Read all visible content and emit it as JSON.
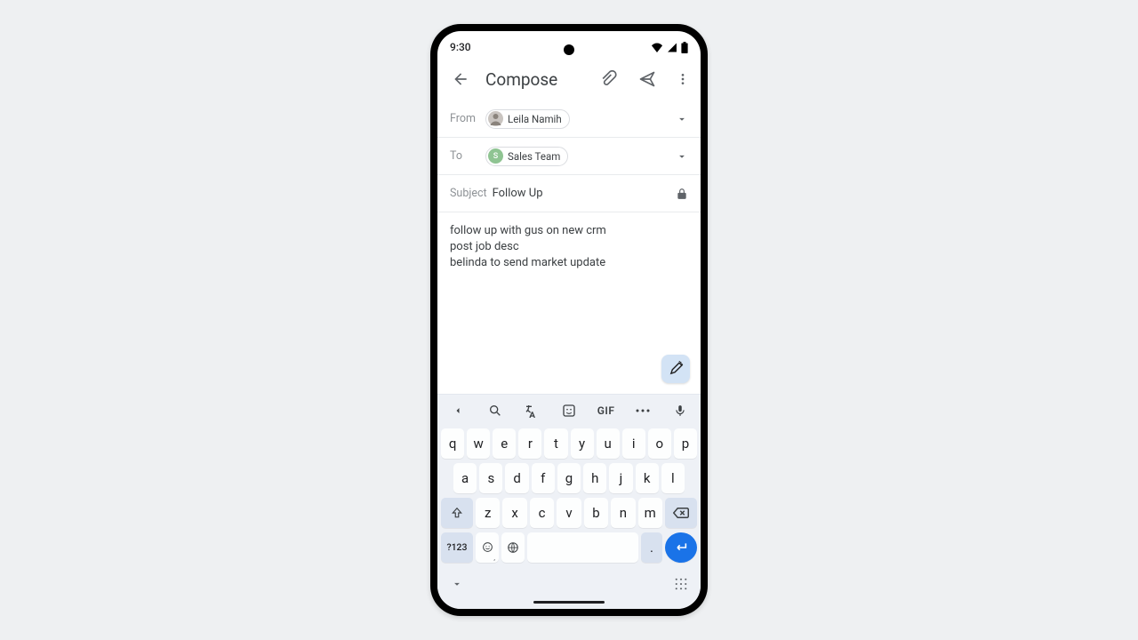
{
  "status": {
    "time": "9:30"
  },
  "appbar": {
    "title": "Compose"
  },
  "from": {
    "label": "From",
    "name": "Leila Namih"
  },
  "to": {
    "label": "To",
    "name": "Sales Team",
    "initial": "S"
  },
  "subject": {
    "label": "Subject",
    "value": "Follow Up"
  },
  "body": {
    "line1": "follow up with gus on new crm",
    "line2": "post job desc",
    "line3": "belinda to send market update"
  },
  "kbd": {
    "gif": "GIF",
    "row1": {
      "k0": "q",
      "k1": "w",
      "k2": "e",
      "k3": "r",
      "k4": "t",
      "k5": "y",
      "k6": "u",
      "k7": "i",
      "k8": "o",
      "k9": "p"
    },
    "row2": {
      "k0": "a",
      "k1": "s",
      "k2": "d",
      "k3": "f",
      "k4": "g",
      "k5": "h",
      "k6": "j",
      "k7": "k",
      "k8": "l"
    },
    "row3": {
      "k0": "z",
      "k1": "x",
      "k2": "c",
      "k3": "v",
      "k4": "b",
      "k5": "n",
      "k6": "m"
    },
    "row4": {
      "sym": "?123",
      "comma": ",",
      "period": "."
    }
  }
}
